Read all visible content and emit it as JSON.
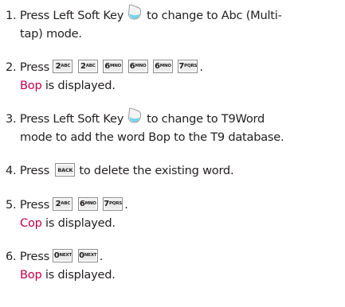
{
  "steps": [
    {
      "num": "1.",
      "text_a": "Press Left Soft Key",
      "text_b": "to change to Abc (Multi-",
      "line2": "tap) mode.",
      "softkey_icon": "left-soft-key-icon"
    },
    {
      "num": "2.",
      "text_a": "Press",
      "keys": [
        {
          "main": "2",
          "sub": "ABC"
        },
        {
          "main": "2",
          "sub": "ABC"
        },
        {
          "main": "6",
          "sub": "MNO"
        },
        {
          "main": "6",
          "sub": "MNO"
        },
        {
          "main": "6",
          "sub": "MNO"
        },
        {
          "main": "7",
          "sub": "PQRS"
        }
      ],
      "end": ".",
      "result_word": "Bop",
      "result_text": "is displayed."
    },
    {
      "num": "3.",
      "text_a": "Press Left Soft Key",
      "text_b": "to change to T9Word",
      "line2": "mode to add the word Bop to the T9 database.",
      "softkey_icon": "left-soft-key-icon"
    },
    {
      "num": "4.",
      "text_a": "Press",
      "key": {
        "main": "BACK"
      },
      "text_b": "to delete the existing word."
    },
    {
      "num": "5.",
      "text_a": "Press",
      "keys": [
        {
          "main": "2",
          "sub": "ABC"
        },
        {
          "main": "6",
          "sub": "MNO"
        },
        {
          "main": "7",
          "sub": "PQRS"
        }
      ],
      "end": ".",
      "result_word": "Cop",
      "result_text": "is displayed."
    },
    {
      "num": "6.",
      "text_a": "Press",
      "keys": [
        {
          "main": "0",
          "sub": "NEXT"
        },
        {
          "main": "0",
          "sub": "NEXT"
        }
      ],
      "end": ".",
      "result_word": "Bop",
      "result_text": "is displayed."
    }
  ],
  "colors": {
    "text": "#231f20",
    "highlight": "#c4004a",
    "softkey_fill": "#6fd3ec",
    "key_fill": "#ebebeb"
  }
}
